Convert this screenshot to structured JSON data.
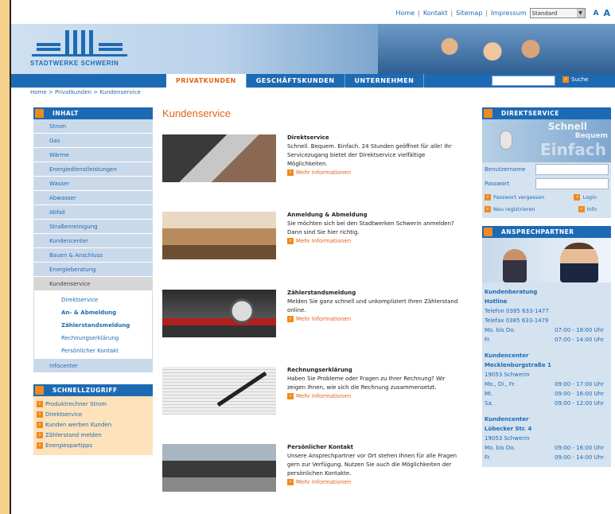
{
  "utility": {
    "links": [
      "Home",
      "Kontakt",
      "Sitemap",
      "Impressum"
    ],
    "select_value": "Standard",
    "font_sizes": [
      "A",
      "A"
    ]
  },
  "logo": {
    "name": "STADTWERKE SCHWERIN"
  },
  "nav": {
    "tabs": [
      "PRIVATKUNDEN",
      "GESCHÄFTSKUNDEN",
      "UNTERNEHMEN"
    ],
    "search_button": "Suche"
  },
  "breadcrumb": "Home > Privatkunden > Kundenservice",
  "leftnav": {
    "header": "INHALT",
    "items": [
      "Strom",
      "Gas",
      "Wärme",
      "Energiedienstleistungen",
      "Wasser",
      "Abwasser",
      "Abfall",
      "Straßenreinigung",
      "Kundencenter",
      "Bauen & Anschluss",
      "Energieberatung",
      "Kundenservice"
    ],
    "sub": [
      "Direktservice",
      "An- & Abmeldung",
      "Zählerstandsmeldung",
      "Rechnungserklärung",
      "Persönlicher Kontakt"
    ],
    "last": "Infocenter"
  },
  "quick": {
    "header": "SCHNELLZUGRIFF",
    "links": [
      "Produktrechner Strom",
      "Direktservice",
      "Kunden werben Kunden",
      "Zählerstand melden",
      "Energiespartipps"
    ]
  },
  "main": {
    "title": "Kundenservice",
    "more_label": "Mehr Informationen",
    "entries": [
      {
        "title": "Direktservice",
        "body": "Schnell. Bequem. Einfach. 24 Stunden geöffnet für alle! Ihr Servicezugang bietet der Direktservice vielfältige Möglichkeiten."
      },
      {
        "title": "Anmeldung & Abmeldung",
        "body": "Sie möchten sich bei den Stadtwerken Schwerin anmelden? Dann sind Sie hier richtig."
      },
      {
        "title": "Zählerstandsmeldung",
        "body": "Melden Sie ganz schnell und unkompliziert Ihren Zählerstand online."
      },
      {
        "title": "Rechnungserklärung",
        "body": "Haben Sie Probleme oder Fragen zu Ihrer Rechnung? Wir zeigen Ihnen, wie sich die Rechnung zusammensetzt."
      },
      {
        "title": "Persönlicher Kontakt",
        "body": "Unsere Ansprechpartner vor Ort stehen Ihnen für alle Fragen gern zur Verfügung. Nutzen Sie auch die Möglichkeiten der persönlichen Kontakte."
      }
    ]
  },
  "direktservice": {
    "header": "DIREKTSERVICE",
    "words": [
      "Schnell",
      "Bequem",
      "Einfach"
    ],
    "user_label": "Benutzername",
    "pass_label": "Passwort",
    "links": [
      "Passwort vergessen",
      "Login",
      "Neu registrieren",
      "Info"
    ]
  },
  "ansprechpartner": {
    "header": "ANSPRECHPARTNER",
    "lines": [
      {
        "t": "Kundenberatung",
        "b": true
      },
      {
        "t": "Hotline",
        "b": true
      },
      {
        "l": "Telefon 0385 633-1477",
        "r": ""
      },
      {
        "l": "Telefax 0385 633-1479",
        "r": ""
      },
      {
        "l": "Mo. bis Do.",
        "r": "07:00 - 18:00 Uhr"
      },
      {
        "l": "Fr.",
        "r": "07:00 - 14:00 Uhr"
      },
      {
        "gap": true
      },
      {
        "t": "Kundencenter",
        "b": true
      },
      {
        "t": "Mecklenburgstraße 1",
        "b": true
      },
      {
        "l": "19053 Schwerin",
        "r": ""
      },
      {
        "l": "Mo., Di., Fr.",
        "r": "09:00 - 17:00 Uhr"
      },
      {
        "l": "Mi.",
        "r": "09:00 - 16:00 Uhr"
      },
      {
        "l": "Sa.",
        "r": "09:00 - 12:00 Uhr"
      },
      {
        "gap": true
      },
      {
        "t": "Kundencenter",
        "b": true
      },
      {
        "t": "Lübecker Str. 4",
        "b": true
      },
      {
        "l": "19053 Schwerin",
        "r": ""
      },
      {
        "l": "Mo. bis Do.",
        "r": "09:00 - 16:00 Uhr"
      },
      {
        "l": "Fr.",
        "r": "09:00 - 14:00 Uhr"
      }
    ]
  }
}
